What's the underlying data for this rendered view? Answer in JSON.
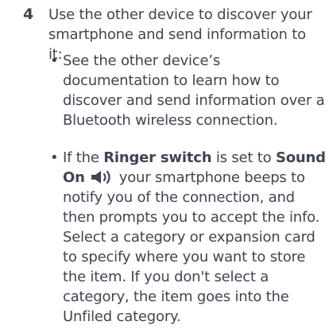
{
  "step": {
    "number": "4",
    "text": "Use the other device to discover your smartphone and send information to it:"
  },
  "bullets": {
    "first": {
      "symbol": "•",
      "text": "See the other device’s documentation to learn how to discover and send information over a Bluetooth wireless connection."
    },
    "second": {
      "symbol": "•",
      "prefix": "If the ",
      "ringer_switch": "Ringer switch",
      "middle": " is set to ",
      "sound_on": "Sound On",
      "icon": "speaker-icon",
      "suffix": " your smartphone beeps to notify you of the connection, and then prompts you to accept the info. Select a category or expansion card to specify where you want to store the item. If you don't select a category, the item goes into the Unfiled category."
    }
  },
  "colors": {
    "text": "#3f4552"
  }
}
